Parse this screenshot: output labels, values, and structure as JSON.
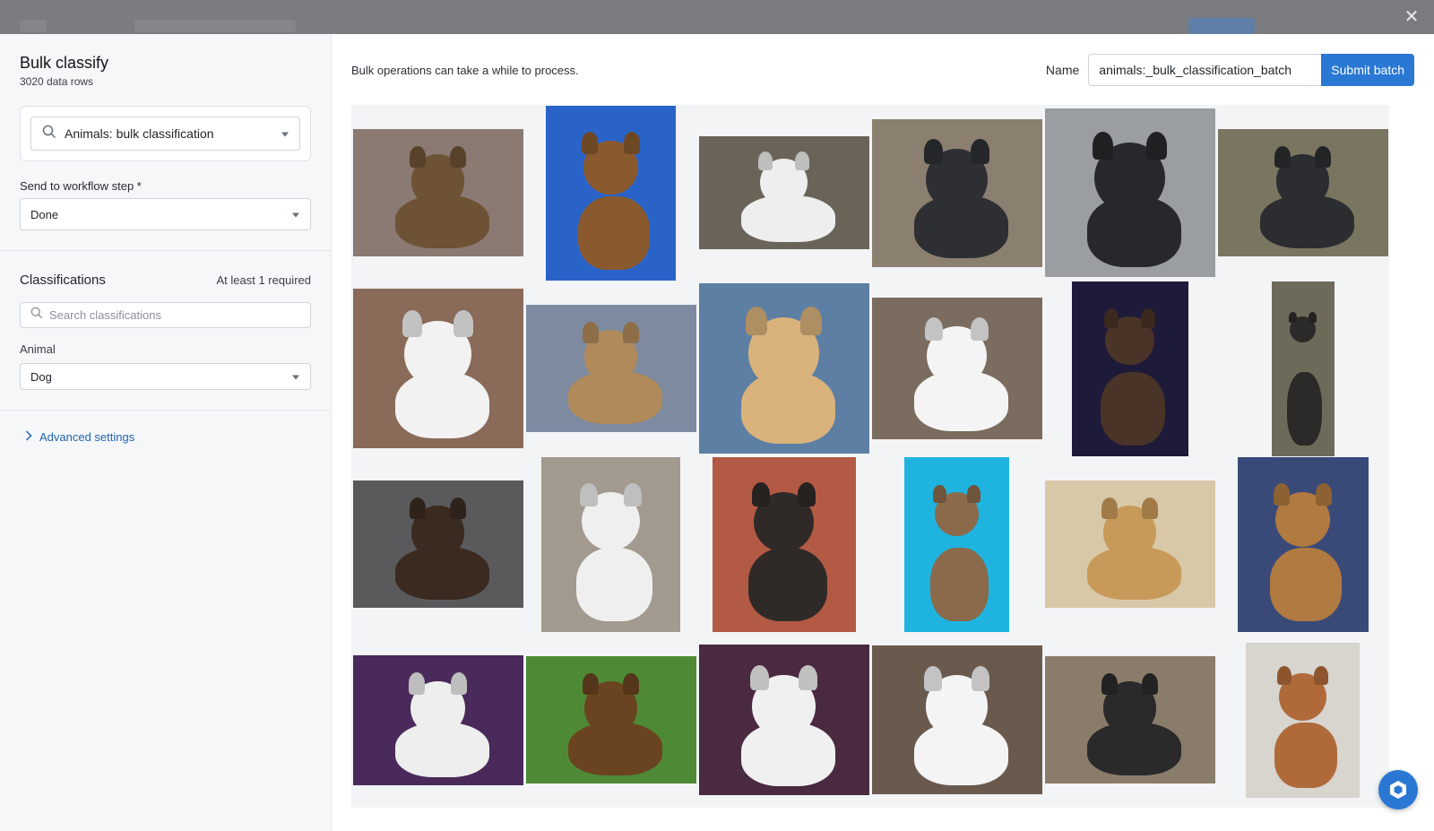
{
  "modal": {
    "title": "Bulk classify",
    "row_count": "3020 data rows",
    "close_icon": "close-icon"
  },
  "sidebar": {
    "project": {
      "value": "Animals: bulk classification"
    },
    "workflow": {
      "label": "Send to workflow step *",
      "value": "Done"
    },
    "classifications": {
      "title": "Classifications",
      "requirement": "At least 1 required",
      "search_placeholder": "Search classifications",
      "animal_label": "Animal",
      "animal_value": "Dog"
    },
    "advanced_label": "Advanced settings"
  },
  "main": {
    "info": "Bulk operations can take a while to process.",
    "name_label": "Name",
    "name_value": "animals:_bulk_classification_batch",
    "submit_label": "Submit batch",
    "help_icon": "help-chat-icon"
  },
  "images": [
    {
      "w": 190,
      "h": 142,
      "bg": "#8a7a72",
      "dog": "#6e5236"
    },
    {
      "w": 145,
      "h": 195,
      "bg": "#2a63c8",
      "dog": "#8a5a2e"
    },
    {
      "w": 190,
      "h": 126,
      "bg": "#6a6458",
      "dog": "#eeeeee"
    },
    {
      "w": 190,
      "h": 165,
      "bg": "#8b7f70",
      "dog": "#2d2f33"
    },
    {
      "w": 190,
      "h": 188,
      "bg": "#9a9ea3",
      "dog": "#26282b"
    },
    {
      "w": 190,
      "h": 142,
      "bg": "#7a7560",
      "dog": "#2b2d30"
    },
    {
      "w": 190,
      "h": 178,
      "bg": "#8a6a58",
      "dog": "#f2f2f2"
    },
    {
      "w": 190,
      "h": 142,
      "bg": "#7d8aa0",
      "dog": "#b08a5a"
    },
    {
      "w": 190,
      "h": 190,
      "bg": "#5d7fa3",
      "dog": "#d9b27c"
    },
    {
      "w": 190,
      "h": 158,
      "bg": "#7a6c5e",
      "dog": "#f4f4f4"
    },
    {
      "w": 130,
      "h": 195,
      "bg": "#1d1a3a",
      "dog": "#4a3327"
    },
    {
      "w": 70,
      "h": 195,
      "bg": "#6d6a5a",
      "dog": "#2b2a28"
    },
    {
      "w": 190,
      "h": 142,
      "bg": "#5a5a5c",
      "dog": "#3a2a20"
    },
    {
      "w": 155,
      "h": 195,
      "bg": "#a29a8e",
      "dog": "#efefef"
    },
    {
      "w": 160,
      "h": 195,
      "bg": "#b25a44",
      "dog": "#2f2a28"
    },
    {
      "w": 117,
      "h": 195,
      "bg": "#1fb4e0",
      "dog": "#8a6a4a"
    },
    {
      "w": 190,
      "h": 142,
      "bg": "#d8c8a8",
      "dog": "#c89a5a"
    },
    {
      "w": 146,
      "h": 195,
      "bg": "#3a4a78",
      "dog": "#b07a40"
    },
    {
      "w": 190,
      "h": 145,
      "bg": "#4a2a5a",
      "dog": "#eeeeee"
    },
    {
      "w": 190,
      "h": 142,
      "bg": "#4e8a36",
      "dog": "#6a4420"
    },
    {
      "w": 190,
      "h": 168,
      "bg": "#4a2a40",
      "dog": "#f0f0f0"
    },
    {
      "w": 190,
      "h": 166,
      "bg": "#6a5a4e",
      "dog": "#f4f4f4"
    },
    {
      "w": 190,
      "h": 142,
      "bg": "#8a7c6a",
      "dog": "#2a2a2a"
    },
    {
      "w": 127,
      "h": 173,
      "bg": "#d8d4ce",
      "dog": "#b06a3a"
    }
  ]
}
